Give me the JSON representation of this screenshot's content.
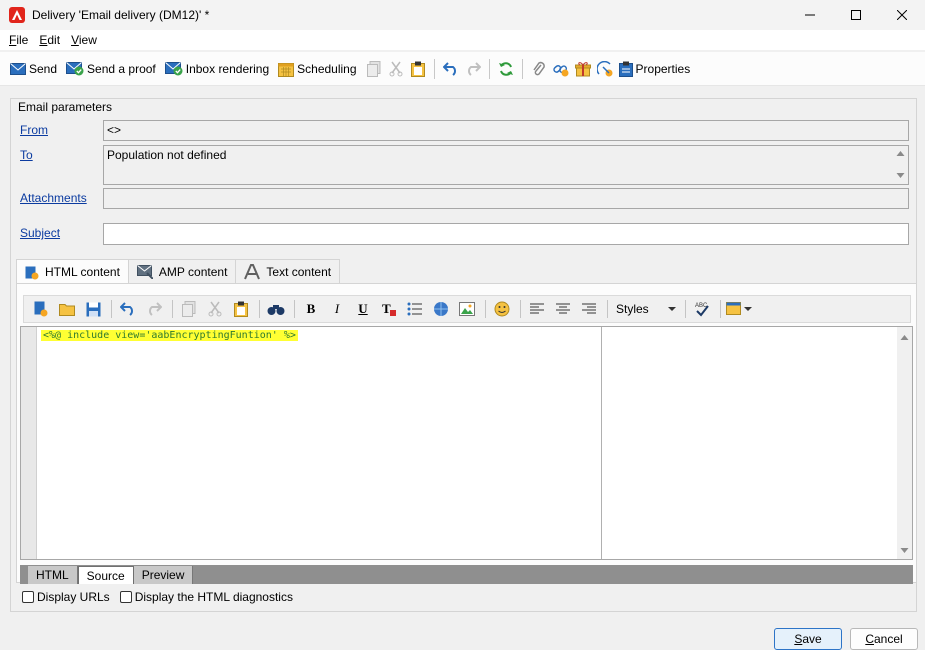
{
  "window": {
    "title": "Delivery 'Email delivery (DM12)' *",
    "minimize_icon": "minimize-icon",
    "maximize_icon": "maximize-icon",
    "close_icon": "close-icon"
  },
  "menu": [
    {
      "underline": "F",
      "rest": "ile"
    },
    {
      "underline": "E",
      "rest": "dit"
    },
    {
      "underline": "V",
      "rest": "iew"
    }
  ],
  "toolbar": {
    "send_label": "Send",
    "send_proof_label": "Send a proof",
    "inbox_rendering_label": "Inbox rendering",
    "scheduling_label": "Scheduling",
    "properties_label": "Properties"
  },
  "email_params": {
    "group_title": "Email parameters",
    "from_label": "From",
    "from_value": "<>",
    "to_label": "To",
    "to_value": "Population not defined",
    "attachments_label": "Attachments",
    "attachments_value": "",
    "subject_label": "Subject",
    "subject_value": ""
  },
  "content_tabs": [
    {
      "label": "HTML content",
      "active": true
    },
    {
      "label": "AMP content",
      "active": false
    },
    {
      "label": "Text content",
      "active": false
    }
  ],
  "editor": {
    "styles_label": "Styles",
    "code": "<%@ include view='aabEncryptingFuntion' %>"
  },
  "bottom_tabs": [
    {
      "label": "HTML",
      "active": false
    },
    {
      "label": "Source",
      "active": true
    },
    {
      "label": "Preview",
      "active": false
    }
  ],
  "options": {
    "display_urls": "Display URLs",
    "display_diagnostics": "Display the HTML diagnostics"
  },
  "buttons": {
    "save_u": "S",
    "save_rest": "ave",
    "cancel_u": "C",
    "cancel_rest": "ancel"
  },
  "colors": {
    "link": "#0b3ba0",
    "highlight": "#ffff33",
    "accent": "#2d74c7"
  }
}
